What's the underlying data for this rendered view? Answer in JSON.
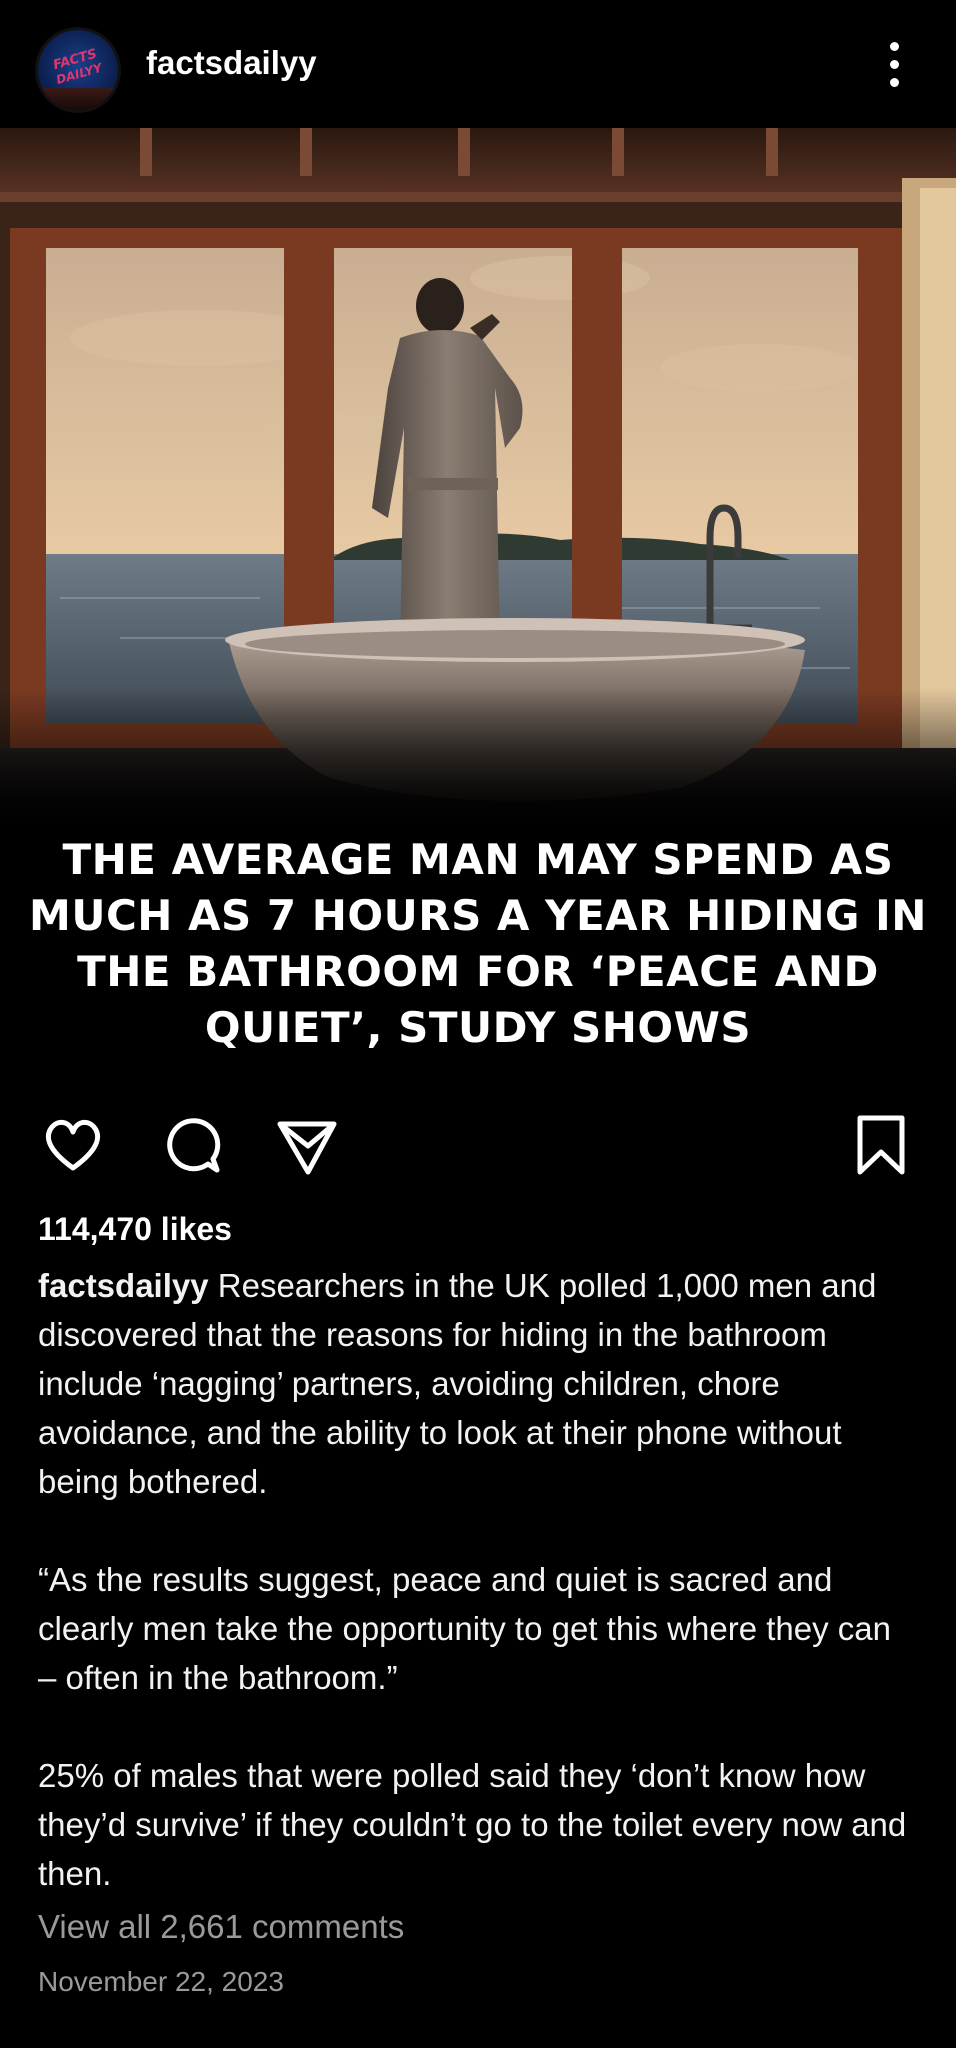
{
  "header": {
    "username": "factsdailyy",
    "avatar_logo_text": [
      "FACTS",
      "DAILYY"
    ],
    "avatar_accent": "#e0356d",
    "more_icon": "more-vertical-icon"
  },
  "post": {
    "image_description_icon": "photo",
    "headline": "THE AVERAGE MAN MAY SPEND AS MUCH AS 7 HOURS A YEAR HIDING IN THE BATHROOM FOR ‘PEACE AND QUIET’, STUDY SHOWS"
  },
  "actions": {
    "like_icon": "heart-icon",
    "comment_icon": "comment-icon",
    "share_icon": "send-icon",
    "save_icon": "bookmark-icon"
  },
  "caption": {
    "likes": "114,470 likes",
    "username": "factsdailyy",
    "paragraph1": " Researchers in the UK polled 1,000 men and discovered that the reasons for hiding in the bathroom include ‘nagging’ partners, avoiding children, chore avoidance, and the ability to look at their phone without being bothered.",
    "paragraph2": "“As the results suggest, peace and quiet is sacred and clearly men take the opportunity to get this where they can – often in the bathroom.”",
    "paragraph3": "25% of males that were polled said they ‘don’t know how they’d survive’ if they couldn’t go to the toilet every now and then.",
    "view_comments": "View all 2,661 comments",
    "date": "November 22, 2023"
  }
}
